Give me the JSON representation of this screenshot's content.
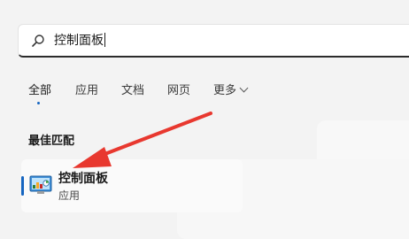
{
  "search": {
    "value": "控制面板",
    "icon": "search-icon"
  },
  "tabs": [
    {
      "label": "全部",
      "active": true
    },
    {
      "label": "应用",
      "active": false
    },
    {
      "label": "文档",
      "active": false
    },
    {
      "label": "网页",
      "active": false
    },
    {
      "label": "更多",
      "active": false
    }
  ],
  "best_match": {
    "heading": "最佳匹配",
    "title": "控制面板",
    "subtitle": "应用",
    "icon": "control-panel-icon"
  },
  "colors": {
    "accent": "#1565c0",
    "annotation": "#e8382f"
  }
}
